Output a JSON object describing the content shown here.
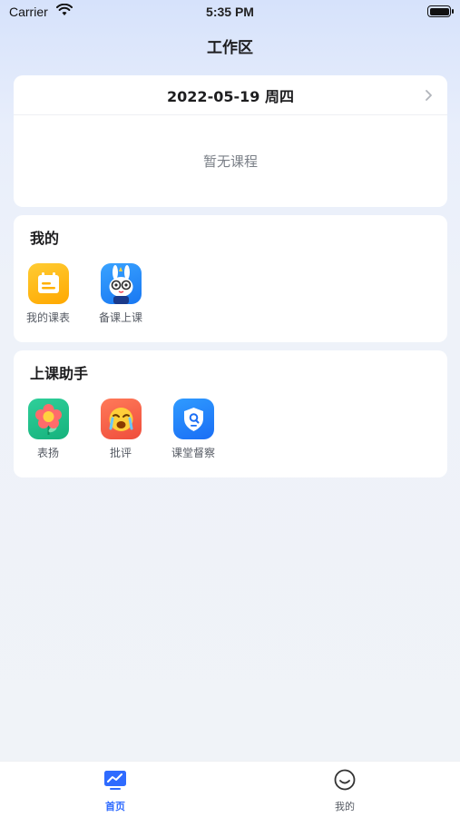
{
  "status_bar": {
    "carrier": "Carrier",
    "time": "5:35 PM"
  },
  "nav": {
    "title": "工作区"
  },
  "schedule": {
    "date": "2022-05-19 周四",
    "empty_text": "暂无课程"
  },
  "mine": {
    "title": "我的",
    "items": [
      {
        "label": "我的课表",
        "icon": "calendar-icon"
      },
      {
        "label": "备课上课",
        "icon": "bunny-mascot-icon"
      }
    ]
  },
  "assistant": {
    "title": "上课助手",
    "items": [
      {
        "label": "表扬",
        "icon": "flower-icon"
      },
      {
        "label": "批评",
        "icon": "crying-face-icon"
      },
      {
        "label": "课堂督察",
        "icon": "shield-search-icon"
      }
    ]
  },
  "tabbar": {
    "active_color": "#2f6bff",
    "inactive_color": "#555a63",
    "items": [
      {
        "label": "首页",
        "icon": "chart-monitor-icon",
        "active": true
      },
      {
        "label": "我的",
        "icon": "smiley-icon",
        "active": false
      }
    ]
  }
}
